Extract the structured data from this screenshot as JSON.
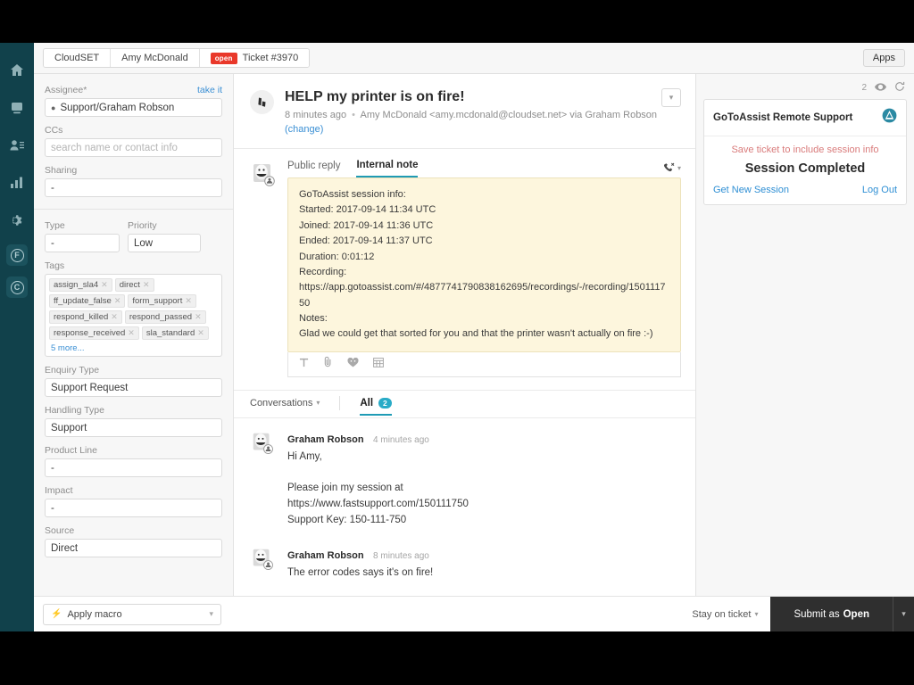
{
  "topbar": {
    "breadcrumbs": [
      {
        "label": "CloudSET"
      },
      {
        "label": "Amy McDonald"
      }
    ],
    "status_pill": "open",
    "ticket_label": "Ticket #3970",
    "apps_button": "Apps"
  },
  "rail": {
    "items": [
      {
        "name": "home-icon"
      },
      {
        "name": "tickets-icon"
      },
      {
        "name": "customers-icon"
      },
      {
        "name": "reports-icon"
      },
      {
        "name": "settings-icon"
      },
      {
        "name": "app-f-badge",
        "letter": "F"
      },
      {
        "name": "app-c-badge",
        "letter": "C"
      }
    ]
  },
  "sidebar": {
    "assignee": {
      "label": "Assignee*",
      "action": "take it",
      "value": "Support/Graham Robson"
    },
    "ccs": {
      "label": "CCs",
      "placeholder": "search name or contact info",
      "value": ""
    },
    "sharing": {
      "label": "Sharing",
      "value": "-"
    },
    "type": {
      "label": "Type",
      "value": "-"
    },
    "priority": {
      "label": "Priority",
      "value": "Low"
    },
    "tags_label": "Tags",
    "tags": [
      "assign_sla4",
      "direct",
      "ff_update_false",
      "form_support",
      "respond_killed",
      "respond_passed",
      "response_received",
      "sla_standard"
    ],
    "tags_more": "5 more...",
    "enquiry_type": {
      "label": "Enquiry Type",
      "value": "Support Request"
    },
    "handling_type": {
      "label": "Handling Type",
      "value": "Support"
    },
    "product_line": {
      "label": "Product Line",
      "value": "-"
    },
    "impact": {
      "label": "Impact",
      "value": "-"
    },
    "source": {
      "label": "Source",
      "value": "Direct"
    }
  },
  "ticket": {
    "title": "HELP my printer is on fire!",
    "time": "8 minutes ago",
    "requester": "Amy McDonald <amy.mcdonald@cloudset.net> via Graham Robson",
    "change_link": "(change)"
  },
  "composer": {
    "tabs": [
      {
        "label": "Public reply",
        "active": false
      },
      {
        "label": "Internal note",
        "active": true
      }
    ],
    "note_text": "GoToAssist session info:\nStarted: 2017-09-14 11:34 UTC\nJoined: 2017-09-14 11:36 UTC\nEnded: 2017-09-14 11:37 UTC\nDuration: 0:01:12\nRecording:\nhttps://app.gotoassist.com/#/4877741790838162695/recordings/-/recording/150111750\nNotes:\nGlad we could get that sorted for you and that the printer wasn't actually on fire :-)",
    "toolbar_icons": [
      "text-format-icon",
      "attachment-icon",
      "emoji-icon",
      "table-icon"
    ]
  },
  "conversations": {
    "label": "Conversations",
    "all_label": "All",
    "all_count": "2",
    "messages": [
      {
        "author": "Graham Robson",
        "time": "4 minutes ago",
        "body": "Hi Amy,\n\nPlease join my session at\nhttps://www.fastsupport.com/150111750\nSupport Key: 150-111-750"
      },
      {
        "author": "Graham Robson",
        "time": "8 minutes ago",
        "body": "The error codes says it's on fire!"
      }
    ]
  },
  "app_panel": {
    "view_count": "2",
    "title": "GoToAssist Remote Support",
    "warning": "Save ticket to include session info",
    "status": "Session Completed",
    "link_left": "Get New Session",
    "link_right": "Log Out"
  },
  "footer": {
    "macro": "Apply macro",
    "stay": "Stay on ticket",
    "submit_prefix": "Submit as",
    "submit_state": "Open"
  }
}
